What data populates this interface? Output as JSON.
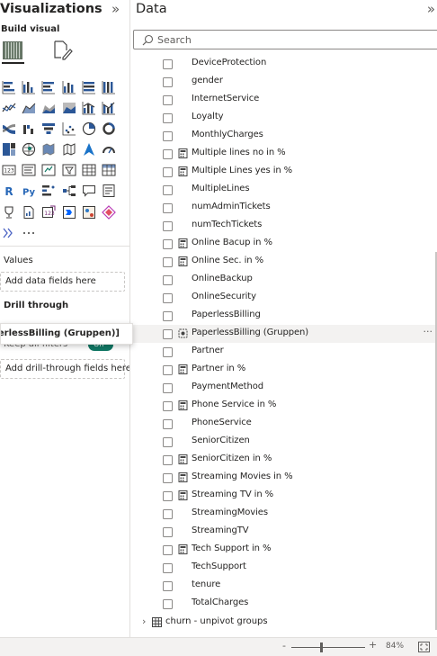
{
  "visualizations": {
    "title": "Visualizations",
    "collapse_glyph": "»",
    "build_visual": "Build visual",
    "tabs": [
      {
        "icon": "build-visual-grid-icon",
        "selected": true
      },
      {
        "icon": "format-visual-brush-icon",
        "selected": false
      }
    ],
    "visual_icons": [
      "stacked-bar-chart-icon",
      "stacked-column-chart-icon",
      "clustered-bar-chart-icon",
      "clustered-column-chart-icon",
      "100-stacked-bar-chart-icon",
      "100-stacked-column-chart-icon",
      "line-chart-icon",
      "area-chart-icon",
      "stacked-area-chart-icon",
      "100-stacked-area-chart-icon",
      "line-and-stacked-column-chart-icon",
      "line-and-clustered-column-chart-icon",
      "ribbon-chart-icon",
      "waterfall-chart-icon",
      "funnel-icon",
      "scatter-chart-icon",
      "pie-chart-icon",
      "donut-chart-icon",
      "treemap-icon",
      "map-icon",
      "filled-map-icon",
      "shape-map-icon",
      "azure-map-icon",
      "gauge-icon",
      "card-icon",
      "multi-row-card-icon",
      "kpi-icon",
      "slicer-icon",
      "table-icon",
      "matrix-icon",
      "r-visual-icon",
      "python-visual-icon",
      "key-influencers-icon",
      "decomposition-tree-icon",
      "qa-icon",
      "smart-narrative-icon",
      "trophy-metrics-icon",
      "paginated-report-icon",
      "power-apps-icon",
      "power-automate-icon",
      "arcgis-icon",
      "diamond-visual-icon",
      "more-visuals-chevrons-icon",
      "more-options-icon"
    ],
    "r_label": "R",
    "py_label": "Py",
    "more_label": "···",
    "values_label": "Values",
    "values_placeholder": "Add data fields here",
    "drill_through_label": "Drill through",
    "keep_all_filters": "Keep all filters",
    "toggle_label": "On",
    "drill_placeholder": "Add drill-through fields here",
    "tooltip_text": "n'[PaperlessBilling (Gruppen)]"
  },
  "data_pane": {
    "title": "Data",
    "collapse_glyph": "»",
    "search_placeholder": "Search",
    "fields": [
      {
        "name": "DeviceProtection",
        "type": "column"
      },
      {
        "name": "gender",
        "type": "column"
      },
      {
        "name": "InternetService",
        "type": "column"
      },
      {
        "name": "Loyalty",
        "type": "column"
      },
      {
        "name": "MonthlyCharges",
        "type": "column"
      },
      {
        "name": "Multiple lines no in %",
        "type": "measure"
      },
      {
        "name": "Multiple Lines yes in %",
        "type": "measure"
      },
      {
        "name": "MultipleLines",
        "type": "column"
      },
      {
        "name": "numAdminTickets",
        "type": "column"
      },
      {
        "name": "numTechTickets",
        "type": "column"
      },
      {
        "name": "Online Bacup in %",
        "type": "measure"
      },
      {
        "name": "Online Sec. in %",
        "type": "measure"
      },
      {
        "name": "OnlineBackup",
        "type": "column"
      },
      {
        "name": "OnlineSecurity",
        "type": "column"
      },
      {
        "name": "PaperlessBilling",
        "type": "column"
      },
      {
        "name": "PaperlessBilling (Gruppen)",
        "type": "group",
        "hover": true
      },
      {
        "name": "Partner",
        "type": "column"
      },
      {
        "name": "Partner in %",
        "type": "measure"
      },
      {
        "name": "PaymentMethod",
        "type": "column"
      },
      {
        "name": "Phone Service in %",
        "type": "measure"
      },
      {
        "name": "PhoneService",
        "type": "column"
      },
      {
        "name": "SeniorCitizen",
        "type": "column"
      },
      {
        "name": "SeniorCitizen in %",
        "type": "measure"
      },
      {
        "name": "Streaming Movies in %",
        "type": "measure"
      },
      {
        "name": "Streaming TV in %",
        "type": "measure"
      },
      {
        "name": "StreamingMovies",
        "type": "column"
      },
      {
        "name": "StreamingTV",
        "type": "column"
      },
      {
        "name": "Tech Support in %",
        "type": "measure"
      },
      {
        "name": "TechSupport",
        "type": "column"
      },
      {
        "name": "tenure",
        "type": "column"
      },
      {
        "name": "TotalCharges",
        "type": "column"
      }
    ],
    "more_options_glyph": "···",
    "table_group": {
      "name": "churn - unpivot groups",
      "chevron": "›",
      "icon": "table-icon"
    }
  },
  "status_bar": {
    "zoom_minus": "-",
    "zoom_plus": "+",
    "zoom_value": "84%",
    "zoom_fraction": 0.84
  },
  "colors": {
    "toggle_on": "#117865",
    "border": "#e1dfdd",
    "text": "#252423",
    "muted": "#605e5c"
  }
}
